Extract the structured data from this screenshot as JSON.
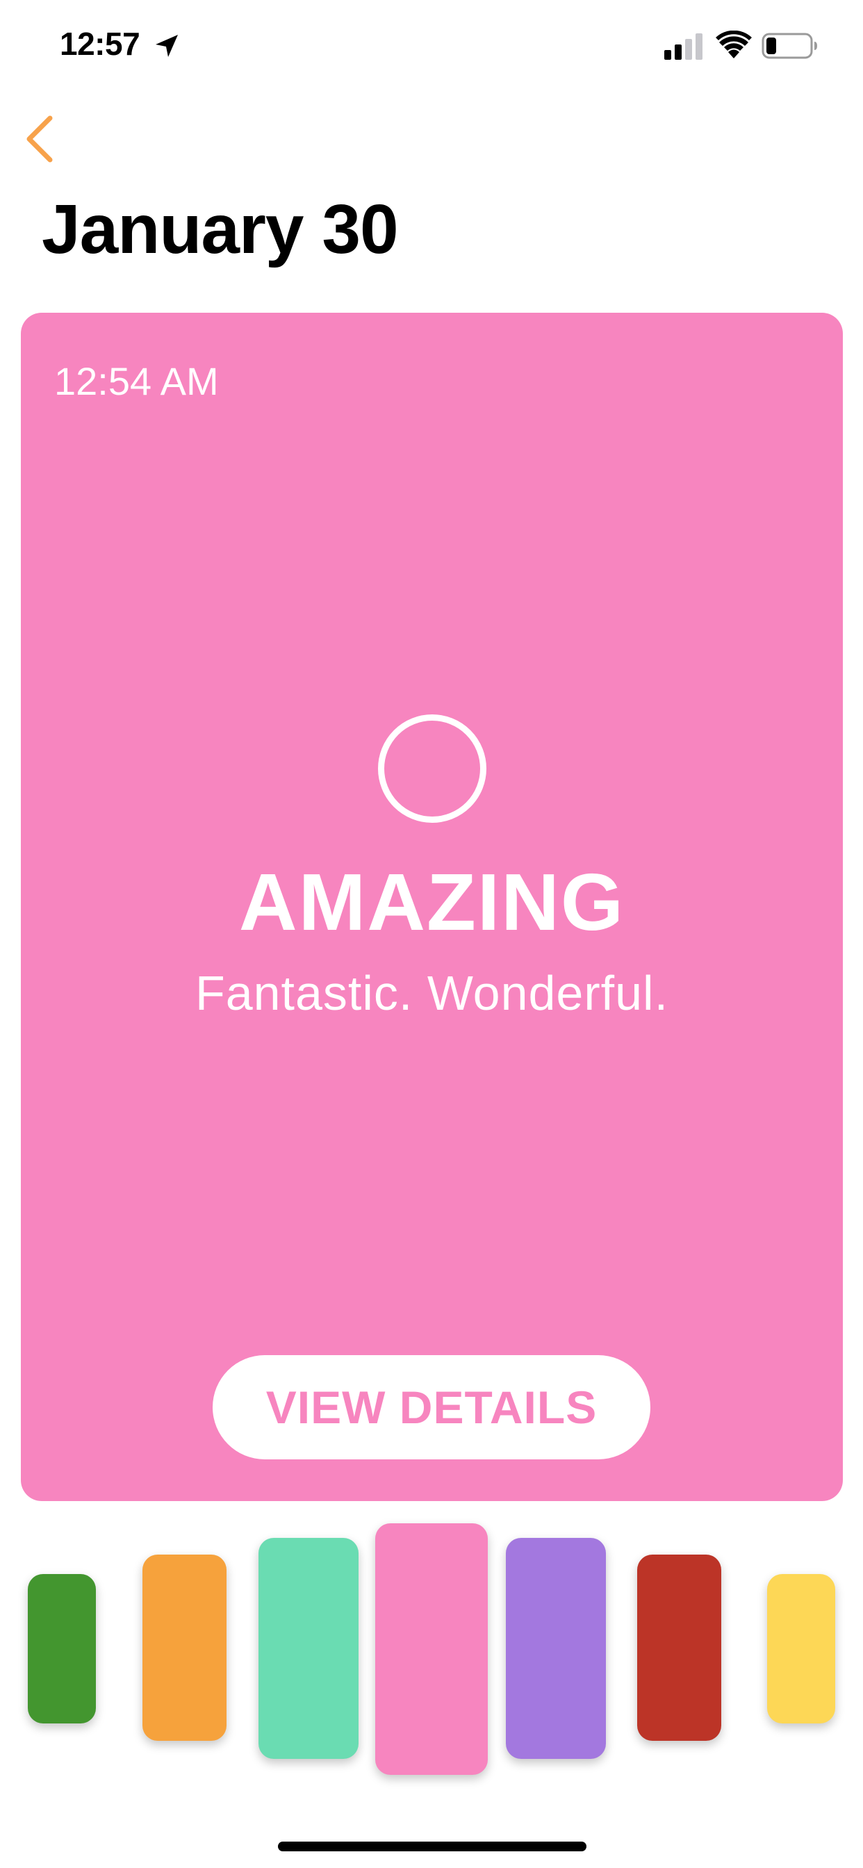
{
  "status_bar": {
    "time": "12:57"
  },
  "header": {
    "title": "January 30"
  },
  "card": {
    "time": "12:54 AM",
    "mood_title": "AMAZING",
    "mood_subtitle": "Fantastic. Wonderful.",
    "button_label": "VIEW DETAILS",
    "background_color": "#f785bf"
  },
  "colors": {
    "accent": "#f7a24b",
    "swatches": [
      "#43962f",
      "#f6a23c",
      "#6adcb2",
      "#f785bf",
      "#a378df",
      "#bc3427",
      "#fdd756"
    ],
    "selected_swatch": 3
  }
}
